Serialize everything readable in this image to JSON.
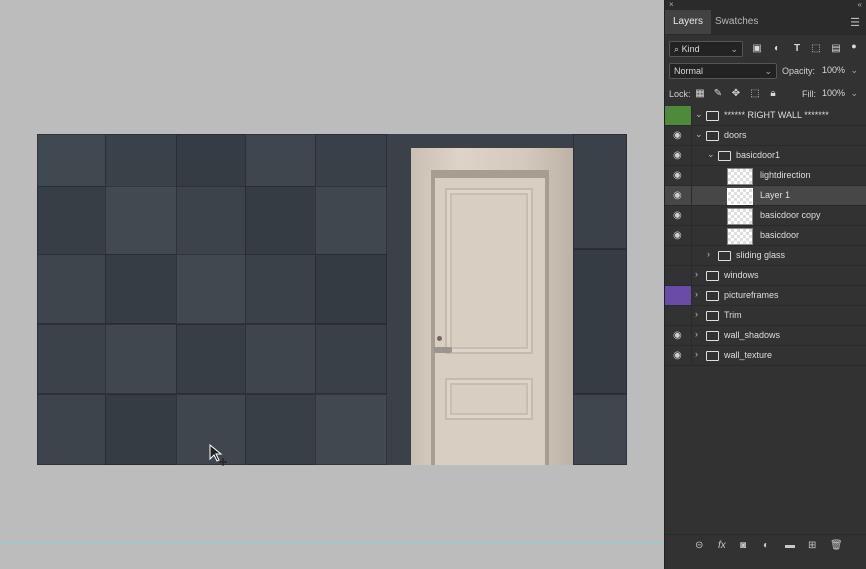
{
  "panel": {
    "close_glyph": "×",
    "collapse_glyph": "«",
    "tabs": [
      {
        "label": "Layers",
        "active": true
      },
      {
        "label": "Swatches",
        "active": false
      }
    ],
    "menu_glyph": "☰",
    "filter": {
      "label": "Kind",
      "icon": "search-icon"
    },
    "blend_mode": "Normal",
    "opacity_label": "Opacity:",
    "opacity_value": "100%",
    "lock_label": "Lock:",
    "fill_label": "Fill:",
    "fill_value": "100%",
    "colors": {
      "green_tag": "#4e8a3a",
      "violet_tag": "#6a4ca8",
      "guide": "#7fd6d8"
    }
  },
  "layers": [
    {
      "name": "****** RIGHT WALL *******",
      "type": "group",
      "visible": false,
      "tag": "green",
      "expanded": true,
      "indent": 0
    },
    {
      "name": "doors",
      "type": "group",
      "visible": true,
      "expanded": true,
      "indent": 0
    },
    {
      "name": "basicdoor1",
      "type": "group",
      "visible": true,
      "expanded": true,
      "indent": 1
    },
    {
      "name": "lightdirection",
      "type": "layer",
      "visible": true,
      "indent": 2
    },
    {
      "name": "Layer 1",
      "type": "layer",
      "visible": true,
      "indent": 2,
      "selected": true
    },
    {
      "name": "basicdoor copy",
      "type": "layer",
      "visible": true,
      "indent": 2
    },
    {
      "name": "basicdoor",
      "type": "layer",
      "visible": true,
      "indent": 2
    },
    {
      "name": "sliding glass",
      "type": "group",
      "visible": false,
      "expanded": false,
      "indent": 1
    },
    {
      "name": "windows",
      "type": "group",
      "visible": false,
      "expanded": false,
      "indent": 0
    },
    {
      "name": "pictureframes",
      "type": "group",
      "visible": false,
      "tag": "violet",
      "expanded": false,
      "indent": 0
    },
    {
      "name": "Trim",
      "type": "group",
      "visible": false,
      "expanded": false,
      "indent": 0
    },
    {
      "name": "wall_shadows",
      "type": "group",
      "visible": true,
      "expanded": false,
      "indent": 0
    },
    {
      "name": "wall_texture",
      "type": "group",
      "visible": true,
      "expanded": false,
      "indent": 0
    }
  ],
  "footer_icons": [
    "link-icon",
    "fx-icon",
    "mask-icon",
    "adjustment-icon",
    "new-group-icon",
    "new-layer-icon",
    "trash-icon"
  ]
}
